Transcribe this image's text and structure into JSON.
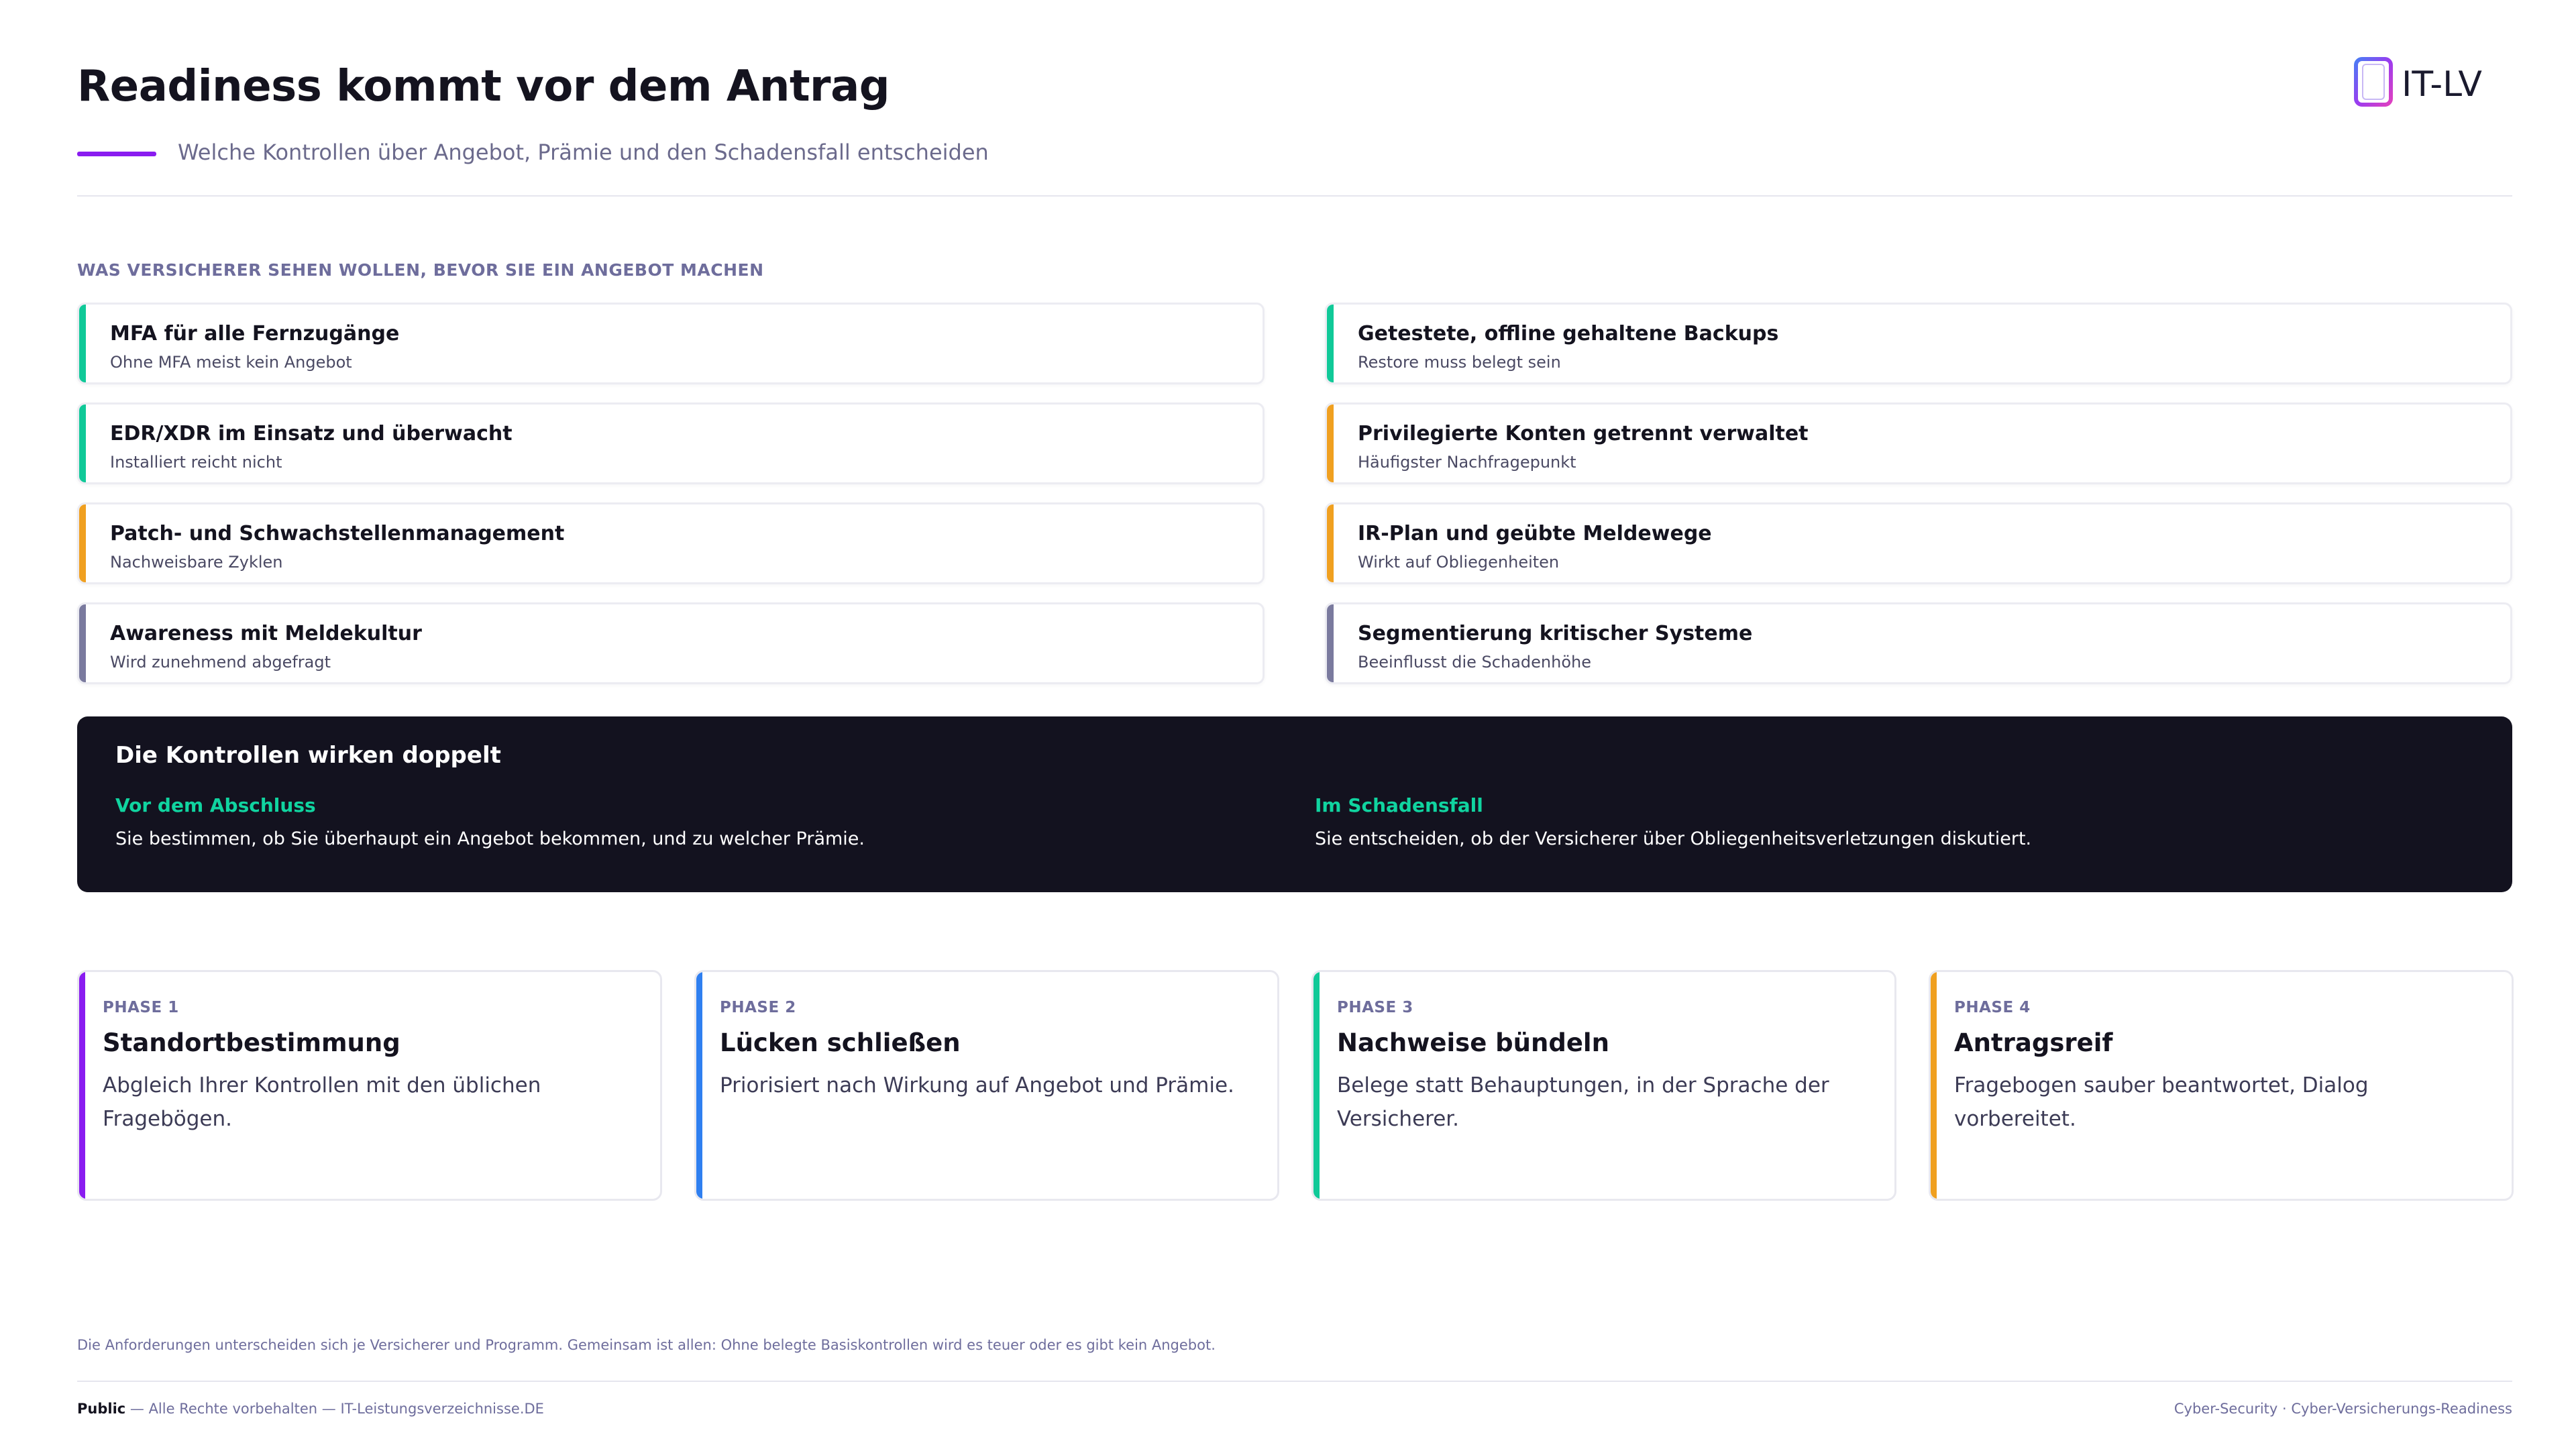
{
  "header": {
    "title": "Readiness kommt vor dem Antrag",
    "subtitle": "Welche Kontrollen über Angebot, Prämie und den Schadensfall entscheiden",
    "logo_text": "IT-LV",
    "accent_color": "#8a1cf0"
  },
  "section_label": "WAS VERSICHERER SEHEN WOLLEN, BEVOR SIE EIN ANGEBOT MACHEN",
  "controls_left": [
    {
      "title": "MFA für alle Fernzugänge",
      "sub": "Ohne MFA meist kein Angebot",
      "color": "#10c998"
    },
    {
      "title": "EDR/XDR im Einsatz und überwacht",
      "sub": "Installiert reicht nicht",
      "color": "#10c998"
    },
    {
      "title": "Patch- und Schwachstellenmanagement",
      "sub": "Nachweisbare Zyklen",
      "color": "#f0a020"
    },
    {
      "title": "Awareness mit Meldekultur",
      "sub": "Wird zunehmend abgefragt",
      "color": "#7a7a9e"
    }
  ],
  "controls_right": [
    {
      "title": "Getestete, offline gehaltene Backups",
      "sub": "Restore muss belegt sein",
      "color": "#10c998"
    },
    {
      "title": "Privilegierte Konten getrennt verwaltet",
      "sub": "Häufigster Nachfragepunkt",
      "color": "#f0a020"
    },
    {
      "title": "IR-Plan und geübte Meldewege",
      "sub": "Wirkt auf Obliegenheiten",
      "color": "#f0a020"
    },
    {
      "title": "Segmentierung kritischer Systeme",
      "sub": "Beeinflusst die Schadenhöhe",
      "color": "#7a7a9e"
    }
  ],
  "effect": {
    "title": "Die Kontrollen wirken doppelt",
    "before": {
      "heading": "Vor dem Abschluss",
      "text": "Sie bestimmen, ob Sie überhaupt ein Angebot bekommen, und zu welcher Prämie."
    },
    "claim": {
      "heading": "Im Schadensfall",
      "text": "Sie entscheiden, ob der Versicherer über Obliegenheitsverletzungen diskutiert."
    }
  },
  "phases": [
    {
      "label": "PHASE 1",
      "title": "Standortbestimmung",
      "text": "Abgleich Ihrer Kontrollen mit den üblichen Fragebögen.",
      "color": "#8a1cf0"
    },
    {
      "label": "PHASE 2",
      "title": "Lücken schließen",
      "text": "Priorisiert nach Wirkung auf Angebot und Prämie.",
      "color": "#2f7ff0"
    },
    {
      "label": "PHASE 3",
      "title": "Nachweise bündeln",
      "text": "Belege statt Behauptungen, in der Sprache der Versicherer.",
      "color": "#10c998"
    },
    {
      "label": "PHASE 4",
      "title": "Antragsreif",
      "text": "Fragebogen sauber beantwortet, Dialog vorbereitet.",
      "color": "#f0a020"
    }
  ],
  "note": "Die Anforderungen unterscheiden sich je Versicherer und Programm. Gemeinsam ist allen: Ohne belegte Basiskontrollen wird es teuer oder es gibt kein Angebot.",
  "footer": {
    "classification": "Public",
    "rights": " — Alle Rechte vorbehalten — IT-Leistungsverzeichnisse.DE",
    "right_text": "Cyber-Security · Cyber-Versicherungs-Readiness"
  }
}
